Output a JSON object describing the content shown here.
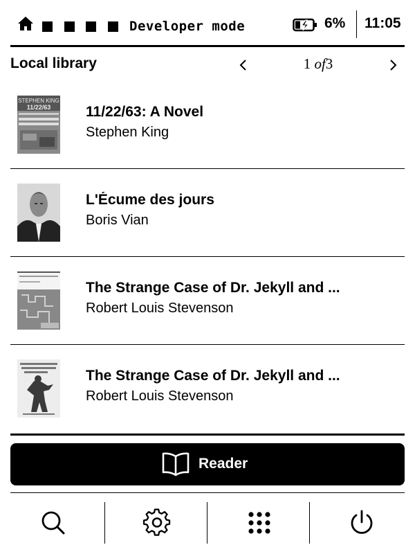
{
  "status_bar": {
    "home_icon": "home-icon",
    "mode_text": "Developer mode",
    "battery_icon": "battery-charging-icon",
    "battery_percent": "6%",
    "time": "11:05"
  },
  "header": {
    "title": "Local library",
    "page_current": "1",
    "page_of": "of",
    "page_total": "3",
    "prev_icon": "chevron-left-icon",
    "next_icon": "chevron-right-icon"
  },
  "books": [
    {
      "title": "11/22/63: A Novel",
      "author": "Stephen King",
      "cover_text": [
        "STEPHEN KING",
        "11/22/63"
      ]
    },
    {
      "title": "L'Écume des jours",
      "author": "Boris Vian"
    },
    {
      "title": "The Strange Case of Dr. Jekyll and ...",
      "author": "Robert Louis Stevenson"
    },
    {
      "title": "The Strange Case of Dr. Jekyll and ...",
      "author": "Robert Louis Stevenson"
    }
  ],
  "reader_button": {
    "label": "Reader",
    "icon": "open-book-icon"
  },
  "toolbar": {
    "icons": [
      "search-icon",
      "gear-icon",
      "apps-grid-icon",
      "power-icon"
    ]
  }
}
